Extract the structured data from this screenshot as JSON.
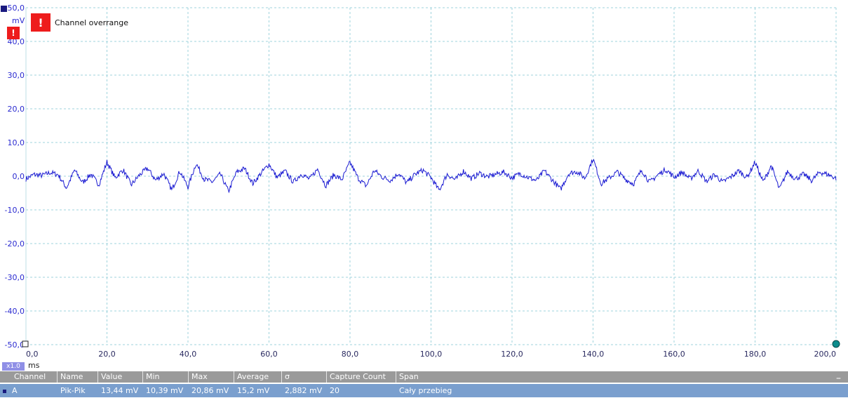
{
  "scope": {
    "y_unit": "mV",
    "x_unit": "ms",
    "zoom": "x1.0",
    "y_ticks": [
      "50,0",
      "40,0",
      "30,0",
      "20,0",
      "10,0",
      "0,0",
      "-10,0",
      "-20,0",
      "-30,0",
      "-40,0",
      "-50,0"
    ],
    "x_ticks": [
      "0,0",
      "20,0",
      "40,0",
      "60,0",
      "80,0",
      "100,0",
      "120,0",
      "140,0",
      "160,0",
      "180,0",
      "200,0"
    ],
    "trace_color": "#1a1ad2",
    "grid_color": "#9fd3dc",
    "axis_color": "#2a2ad0",
    "ylim": [
      -50,
      50
    ],
    "xlim": [
      0,
      200
    ]
  },
  "warning": {
    "glyph": "!",
    "text": "Channel overrange",
    "color": "#ee1c1c"
  },
  "measurements": {
    "headers": [
      "Channel",
      "Name",
      "Value",
      "Min",
      "Max",
      "Average",
      "σ",
      "Capture Count",
      "Span"
    ],
    "row": [
      "A",
      "Pik-Pik",
      "13,44 mV",
      "10,39 mV",
      "20,86 mV",
      "15,2 mV",
      "2,882 mV",
      "20",
      "Cały przebieg"
    ],
    "collapse_glyph": "–"
  },
  "chart_data": {
    "type": "line",
    "x_range": [
      0,
      200
    ],
    "y_range": [
      -50,
      50
    ],
    "series": [
      {
        "x": [
          0,
          2,
          4,
          6,
          8,
          10,
          12,
          14,
          16,
          18,
          20,
          22,
          24,
          26,
          28,
          30,
          32,
          34,
          36,
          38,
          40,
          42,
          44,
          46,
          48,
          50,
          52,
          54,
          56,
          58,
          60,
          62,
          64,
          66,
          68,
          70,
          72,
          74,
          76,
          78,
          80,
          82,
          84,
          86,
          88,
          90,
          92,
          94,
          96,
          98,
          100,
          102,
          104,
          106,
          108,
          110,
          112,
          114,
          116,
          118,
          120,
          122,
          124,
          126,
          128,
          130,
          132,
          134,
          136,
          138,
          140,
          142,
          144,
          146,
          148,
          150,
          152,
          154,
          156,
          158,
          160,
          162,
          164,
          166,
          168,
          170,
          172,
          174,
          176,
          178,
          180,
          182,
          184,
          186,
          188,
          190,
          192,
          194,
          196,
          198,
          200
        ],
        "y": [
          -0.8,
          0.5,
          0.2,
          1.1,
          0.4,
          -3.5,
          1.8,
          -1.9,
          0.6,
          -2.5,
          4.2,
          -0.5,
          1.9,
          -2.6,
          0.3,
          2.4,
          -1.2,
          0.8,
          -4.1,
          1.5,
          -3.2,
          3.8,
          -0.9,
          -1.7,
          0.6,
          -4.5,
          1.2,
          2.3,
          -2.2,
          0.8,
          3.6,
          -0.4,
          1.5,
          -1.8,
          0.7,
          -0.9,
          2.1,
          -2.8,
          0.4,
          -1.0,
          4.1,
          -0.6,
          -2.9,
          1.7,
          -0.3,
          -1.2,
          0.9,
          -2.0,
          0.5,
          1.8,
          -0.4,
          -4.2,
          0.6,
          -1.1,
          1.5,
          -0.7,
          0.9,
          -0.2,
          0.6,
          1.2,
          -0.5,
          0.8,
          -0.4,
          -1.3,
          1.6,
          -1.2,
          -3.9,
          0.8,
          1.4,
          -0.6,
          5.2,
          -2.2,
          -0.5,
          1.3,
          -0.9,
          -2.3,
          1.8,
          -1.8,
          0.4,
          2.0,
          -0.3,
          1.2,
          -0.8,
          1.6,
          -1.6,
          0.5,
          -1.8,
          -0.2,
          1.6,
          -0.4,
          4.2,
          -1.7,
          3.1,
          -3.9,
          1.4,
          -0.8,
          0.6,
          -1.3,
          1.2,
          0.5,
          -0.6
        ]
      }
    ]
  }
}
